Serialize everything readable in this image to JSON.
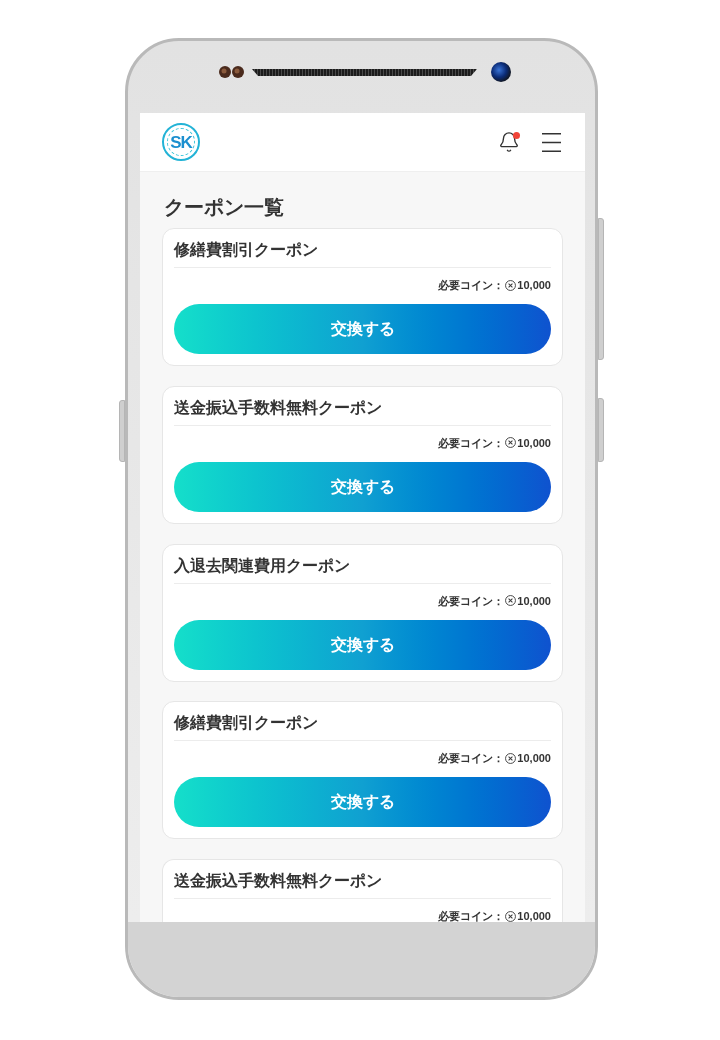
{
  "header": {
    "logo": "SK",
    "notification": {
      "unread": true
    }
  },
  "page_title": "クーポン一覧",
  "coupons": [
    {
      "title": "修繕費割引クーポン",
      "cost_label": "必要コイン：",
      "cost": "10,000",
      "button": "交換する"
    },
    {
      "title": "送金振込手数料無料クーポン",
      "cost_label": "必要コイン：",
      "cost": "10,000",
      "button": "交換する"
    },
    {
      "title": "入退去関連費用クーポン",
      "cost_label": "必要コイン：",
      "cost": "10,000",
      "button": "交換する"
    },
    {
      "title": "修繕費割引クーポン",
      "cost_label": "必要コイン：",
      "cost": "10,000",
      "button": "交換する"
    },
    {
      "title": "送金振込手数料無料クーポン",
      "cost_label": "必要コイン：",
      "cost": "10,000"
    }
  ]
}
